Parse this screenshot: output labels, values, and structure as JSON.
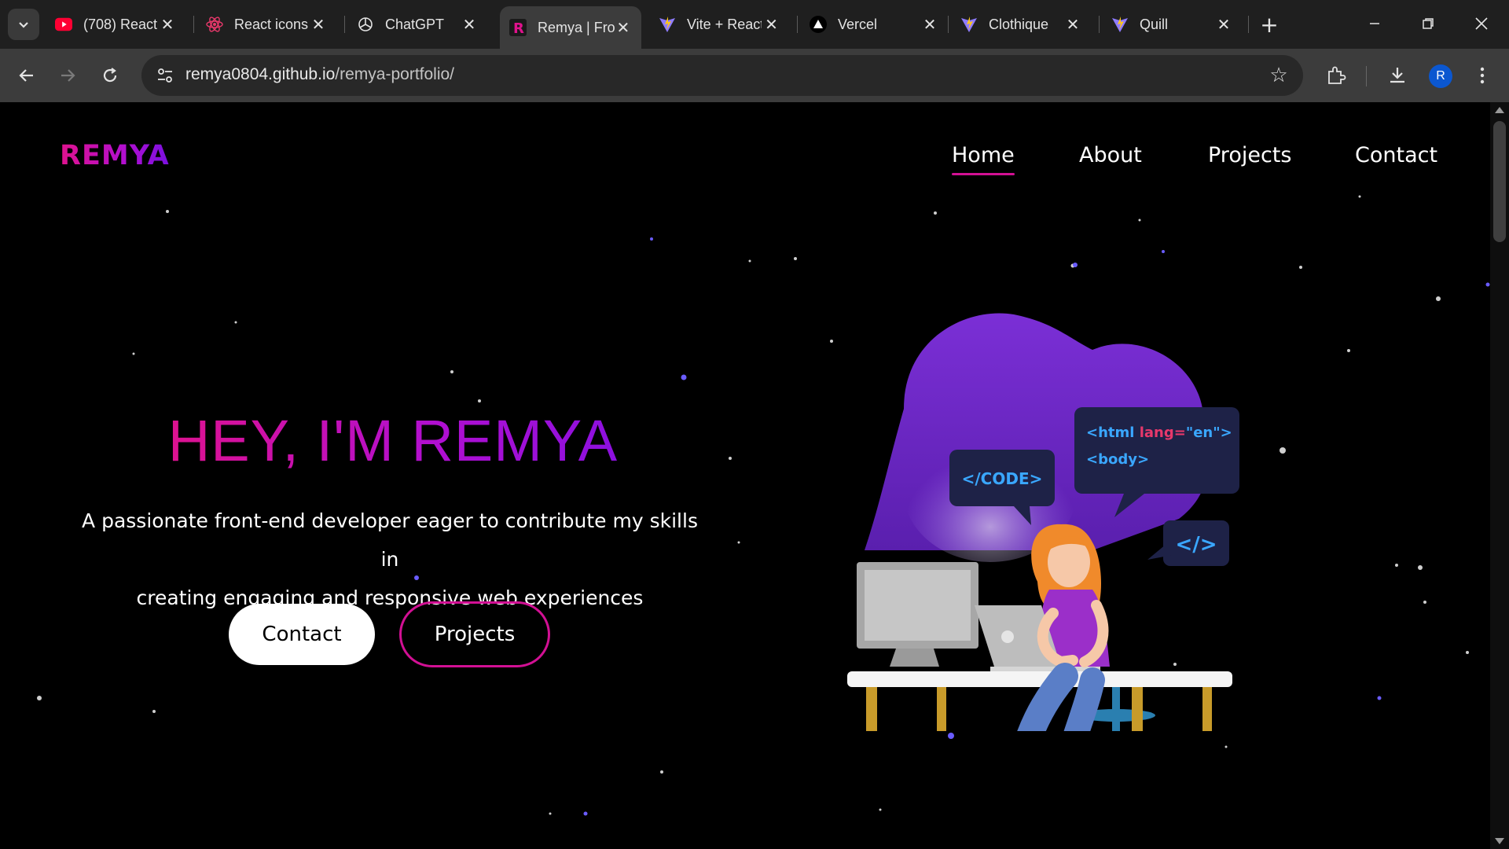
{
  "browser": {
    "tabs": [
      {
        "title": "(708) React",
        "favicon": "youtube-icon"
      },
      {
        "title": "React icons",
        "favicon": "react-icon"
      },
      {
        "title": "ChatGPT",
        "favicon": "chatgpt-icon"
      },
      {
        "title": "Remya | Front",
        "favicon": "r-logo-icon",
        "active": true
      },
      {
        "title": "Vite + React",
        "favicon": "vite-icon"
      },
      {
        "title": "Vercel",
        "favicon": "vercel-icon"
      },
      {
        "title": "Clothique",
        "favicon": "vite-icon"
      },
      {
        "title": "Quill",
        "favicon": "vite-icon"
      }
    ],
    "url_host": "remya0804.github.io",
    "url_path": "/remya-portfolio/",
    "profile_initial": "R"
  },
  "site": {
    "logo": "REMYA",
    "nav": {
      "home": "Home",
      "about": "About",
      "projects": "Projects",
      "contact": "Contact"
    },
    "hero": {
      "title": "HEY, I'M REMYA",
      "subtitle_line1": "A passionate front-end developer eager to contribute my skills in",
      "subtitle_line2": "creating engaging and responsive web experiences",
      "contact_button": "Contact",
      "projects_button": "Projects"
    },
    "illustration": {
      "code_bubble": "</CODE>",
      "html_line1_tag": "<html ",
      "html_line1_attr": "lang=",
      "html_line1_val": "\"en\">",
      "html_line2": "<body>",
      "tag_bubble": "</>"
    }
  },
  "colors": {
    "accent_pink": "#d21094",
    "accent_purple": "#8a10e0",
    "background": "#000000",
    "chrome_dark": "#1f1f1f",
    "chrome_toolbar": "#3c3c3c"
  }
}
